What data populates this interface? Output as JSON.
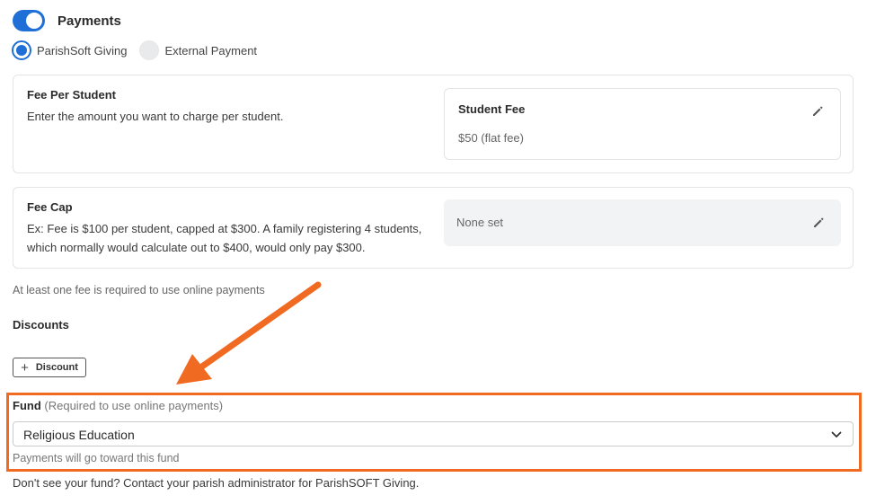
{
  "payments": {
    "toggle_label": "Payments",
    "toggle_on": true,
    "options": [
      {
        "label": "ParishSoft Giving",
        "selected": true
      },
      {
        "label": "External Payment",
        "selected": false
      }
    ]
  },
  "fee_per_student": {
    "title": "Fee Per Student",
    "description": "Enter the amount you want to charge per student.",
    "box_title": "Student Fee",
    "box_value": "$50 (flat fee)",
    "edit_icon": "pencil-icon"
  },
  "fee_cap": {
    "title": "Fee Cap",
    "description": "Ex: Fee is $100 per student, capped at $300. A family registering 4 students, which normally would calculate out to $400, would only pay $300.",
    "box_value": "None set",
    "edit_icon": "pencil-icon"
  },
  "fee_helper": "At least one fee is required to use online payments",
  "discounts": {
    "heading": "Discounts",
    "button_icon": "+",
    "button_label": "Discount"
  },
  "fund": {
    "label": "Fund",
    "note": "(Required to use online payments)",
    "selected_value": "Religious Education",
    "helper": "Payments will go toward this fund",
    "footer": "Don't see your fund? Contact your parish administrator for ParishSOFT Giving."
  },
  "colors": {
    "accent": "#1f6fd6",
    "annotation": "#f06a22"
  }
}
